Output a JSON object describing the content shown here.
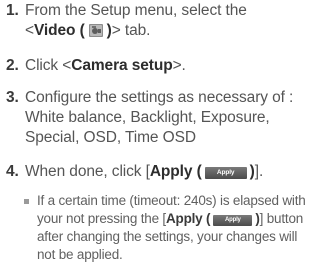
{
  "steps": [
    {
      "number": "1.",
      "line1": "From the Setup menu, select the",
      "line2_prefix": "<",
      "line2_bold": "Video (",
      "line2_bold_close": ")",
      "line2_suffix": "> tab."
    },
    {
      "number": "2.",
      "prefix": "Click <",
      "bold": "Camera setup",
      "suffix": ">."
    },
    {
      "number": "3.",
      "line1": "Configure the settings as necessary of :",
      "line2": "White balance, Backlight, Exposure,",
      "line3": "Special, OSD, Time OSD"
    },
    {
      "number": "4.",
      "prefix": "When done, click [",
      "bold": "Apply (",
      "bold_close": ")",
      "suffix": "]."
    }
  ],
  "note": {
    "line1": "If a certain time (timeout: 240s) is elapsed with",
    "line2_prefix": "your not pressing the [",
    "line2_bold": "Apply (",
    "line2_bold_close": ")",
    "line2_suffix": "] button",
    "line3": "after changing the settings, your changes will",
    "line4": "not be applied."
  },
  "apply_button_label": "Apply",
  "icons": {
    "video_tab": "camera-icon",
    "bullet": "square-bullet-icon"
  }
}
